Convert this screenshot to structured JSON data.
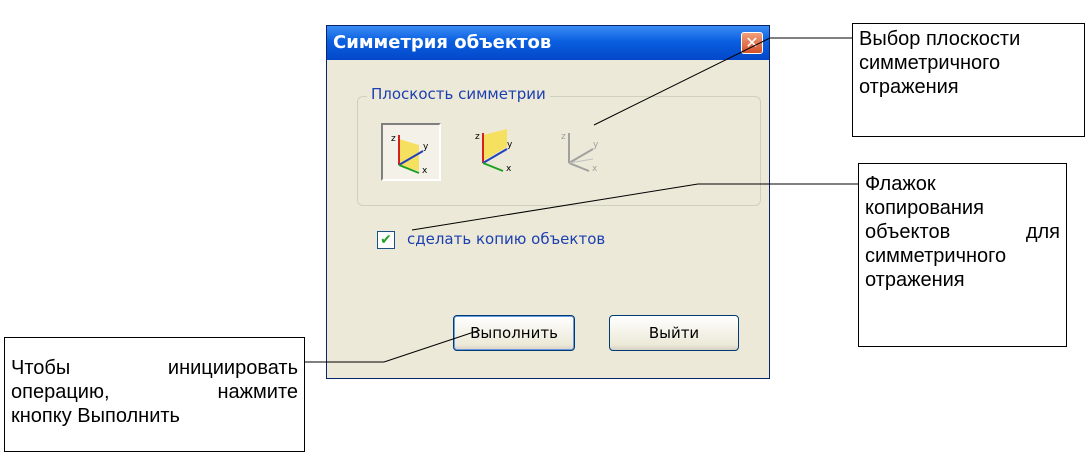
{
  "dialog": {
    "title": "Симметрия объектов",
    "close_glyph": "✕",
    "group_label": "Плоскость симметрии",
    "plane_buttons": [
      {
        "name": "xy-plane",
        "state": "active"
      },
      {
        "name": "yz-plane",
        "state": "normal"
      },
      {
        "name": "xz-plane",
        "state": "disabled"
      }
    ],
    "copy_checkbox": {
      "label": "сделать копию объектов",
      "checked": true,
      "glyph": "✔"
    },
    "execute_label": "Выполнить",
    "exit_label": "Выйти"
  },
  "callouts": {
    "plane_select": [
      "Выбор плоскости",
      "симметричного",
      "отражения"
    ],
    "copy_flag": [
      "Флажок",
      "копирования",
      "объектов для",
      "симметричного",
      "отражения"
    ],
    "execute_hint": [
      "Чтобы инициировать",
      "операцию, нажмите",
      "кнопку Выполнить"
    ]
  },
  "colors": {
    "titlebar": "#0a5fe0",
    "dialog_bg": "#ece9d8",
    "label_blue": "#1c3fb0",
    "close_red": "#d4502a"
  }
}
